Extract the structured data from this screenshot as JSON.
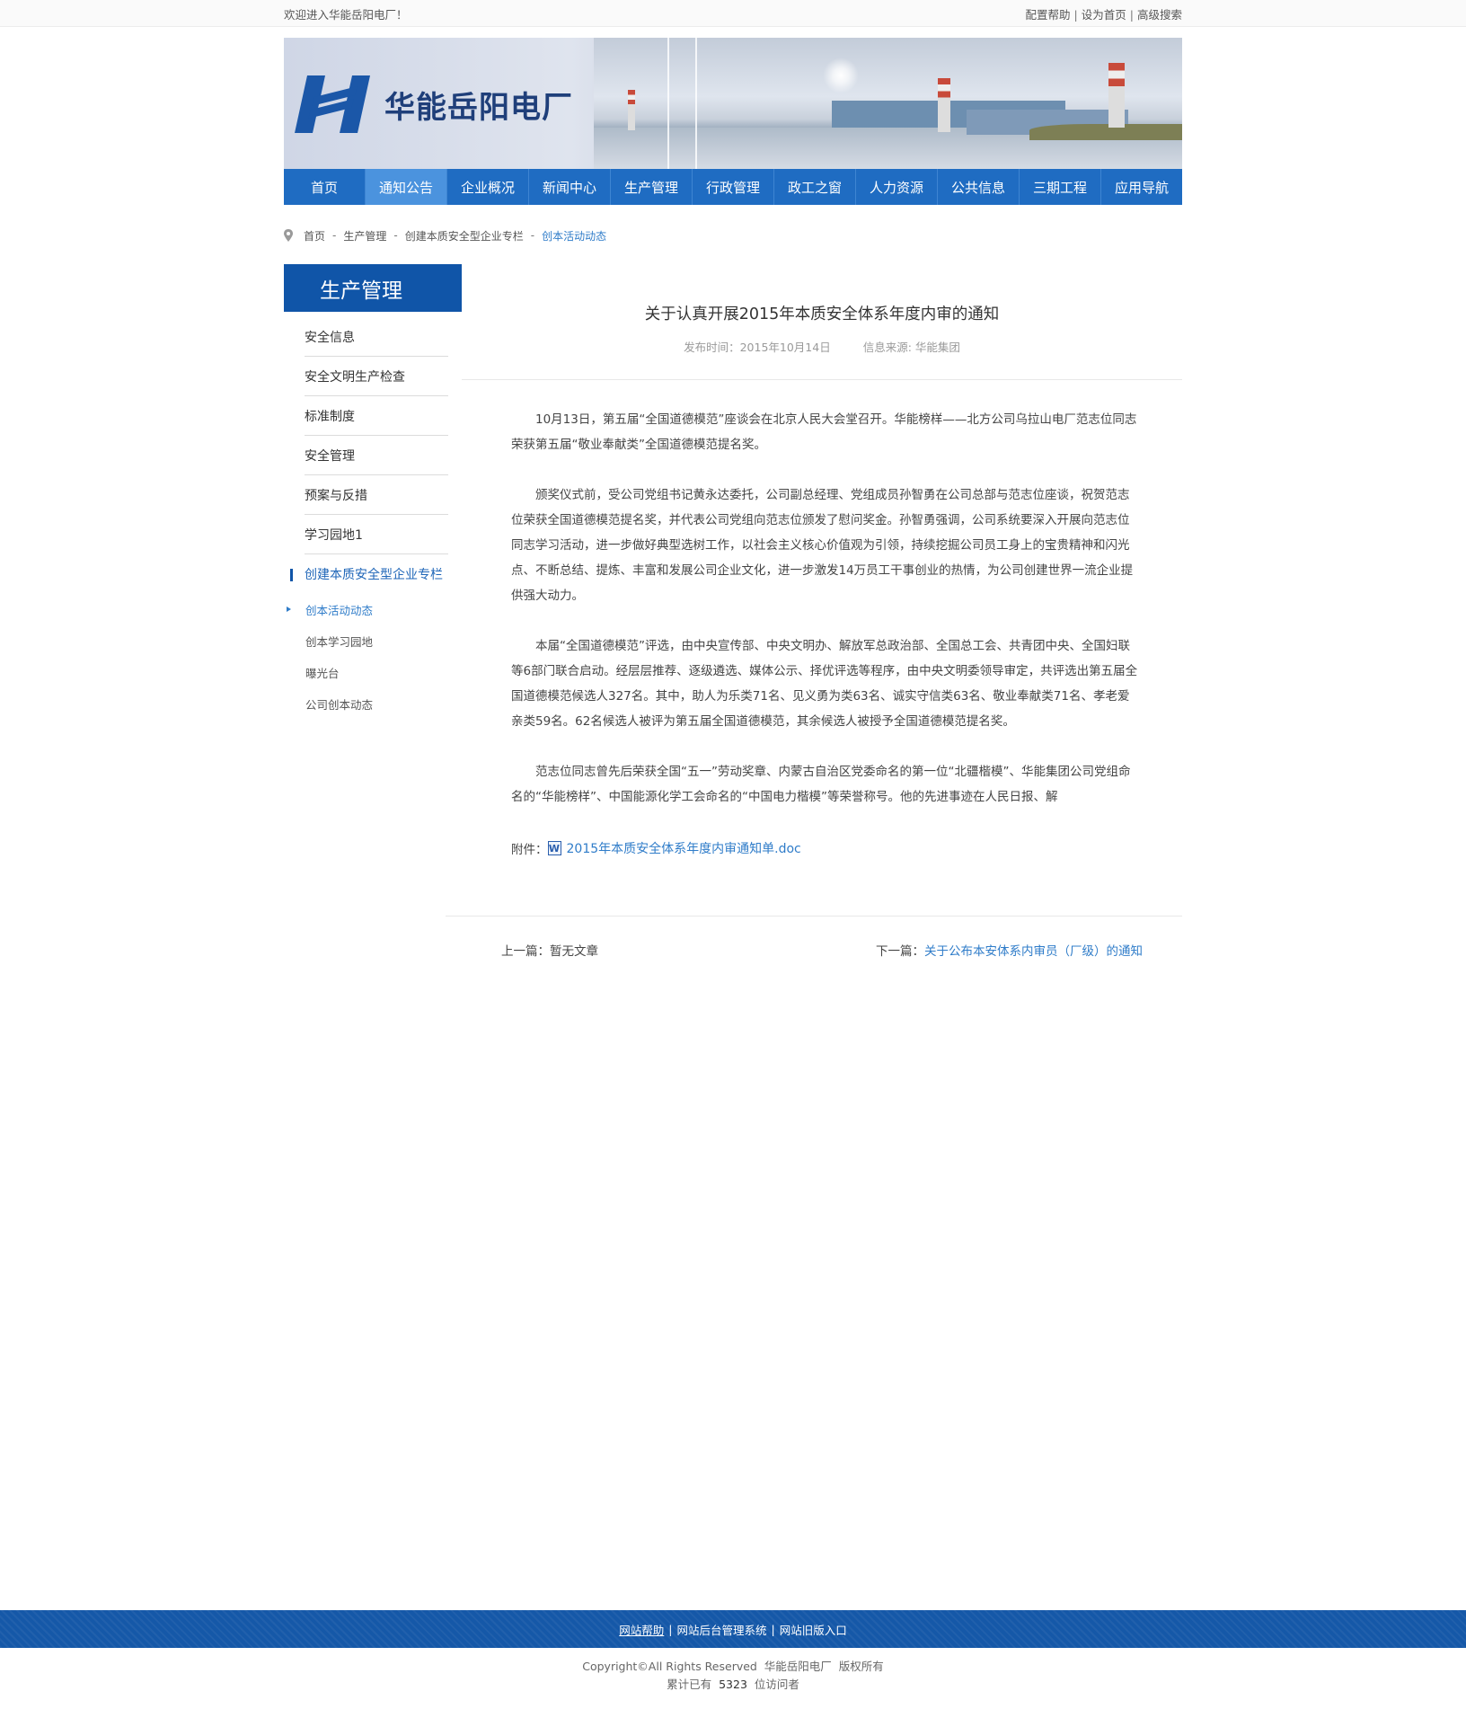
{
  "topbar": {
    "welcome": "欢迎进入华能岳阳电厂！",
    "links": [
      "配置帮助",
      "设为首页",
      "高级搜索"
    ]
  },
  "banner": {
    "logo_text": "华能岳阳电厂"
  },
  "nav": {
    "items": [
      "首页",
      "通知公告",
      "企业概况",
      "新闻中心",
      "生产管理",
      "行政管理",
      "政工之窗",
      "人力资源",
      "公共信息",
      "三期工程",
      "应用导航"
    ],
    "active_index": 1
  },
  "breadcrumb": {
    "items": [
      "首页",
      "生产管理",
      "创建本质安全型企业专栏",
      "创本活动动态"
    ]
  },
  "sidebar": {
    "title": "生产管理",
    "items": [
      "安全信息",
      "安全文明生产检查",
      "标准制度",
      "安全管理",
      "预案与反措",
      "学习园地1",
      "创建本质安全型企业专栏"
    ],
    "subitems": [
      "创本活动动态",
      "创本学习园地",
      "曝光台",
      "公司创本动态"
    ]
  },
  "article": {
    "title": "关于认真开展2015年本质安全体系年度内审的通知",
    "publish_time": "发布时间：2015年10月14日",
    "source": "信息来源: 华能集团",
    "paragraphs": [
      "10月13日，第五届“全国道德模范”座谈会在北京人民大会堂召开。华能榜样——北方公司乌拉山电厂范志位同志荣获第五届“敬业奉献类”全国道德模范提名奖。",
      "颁奖仪式前，受公司党组书记黄永达委托，公司副总经理、党组成员孙智勇在公司总部与范志位座谈，祝贺范志位荣获全国道德模范提名奖，并代表公司党组向范志位颁发了慰问奖金。孙智勇强调，公司系统要深入开展向范志位同志学习活动，进一步做好典型选树工作，以社会主义核心价值观为引领，持续挖掘公司员工身上的宝贵精神和闪光点、不断总结、提炼、丰富和发展公司企业文化，进一步激发14万员工干事创业的热情，为公司创建世界一流企业提供强大动力。",
      "本届“全国道德模范”评选，由中央宣传部、中央文明办、解放军总政治部、全国总工会、共青团中央、全国妇联等6部门联合启动。经层层推荐、逐级遴选、媒体公示、择优评选等程序，由中央文明委领导审定，共评选出第五届全国道德模范候选人327名。其中，助人为乐类71名、见义勇为类63名、诚实守信类63名、敬业奉献类71名、孝老爱亲类59名。62名候选人被评为第五届全国道德模范，其余候选人被授予全国道德模范提名奖。",
      "范志位同志曾先后荣获全国“五一”劳动奖章、内蒙古自治区党委命名的第一位“北疆楷模”、华能集团公司党组命名的“华能榜样”、中国能源化学工会命名的“中国电力楷模”等荣誉称号。他的先进事迹在人民日报、解"
    ],
    "attachment_label": "附件：",
    "attachment_icon": "word-doc-icon",
    "attachment_name": "2015年本质安全体系年度内审通知单.doc",
    "prev_label": "上一篇：",
    "prev_title": "暂无文章",
    "next_label": "下一篇：",
    "next_title": "关于公布本安体系内审员（厂级）的通知"
  },
  "footer": {
    "links": [
      "网站帮助",
      "网站后台管理系统",
      "网站旧版入口"
    ],
    "copyright": "Copyright©All Rights Reserved  华能岳阳电厂  版权所有",
    "visits_prefix": "累计已有",
    "visits_count": "5323",
    "visits_suffix": "位访问者"
  },
  "colors": {
    "nav_bg": "#1f6cc2",
    "nav_active": "#4b93de",
    "sidebar_head": "#1055a8",
    "link": "#2f7cc9",
    "footer_bg": "#1558a8"
  }
}
